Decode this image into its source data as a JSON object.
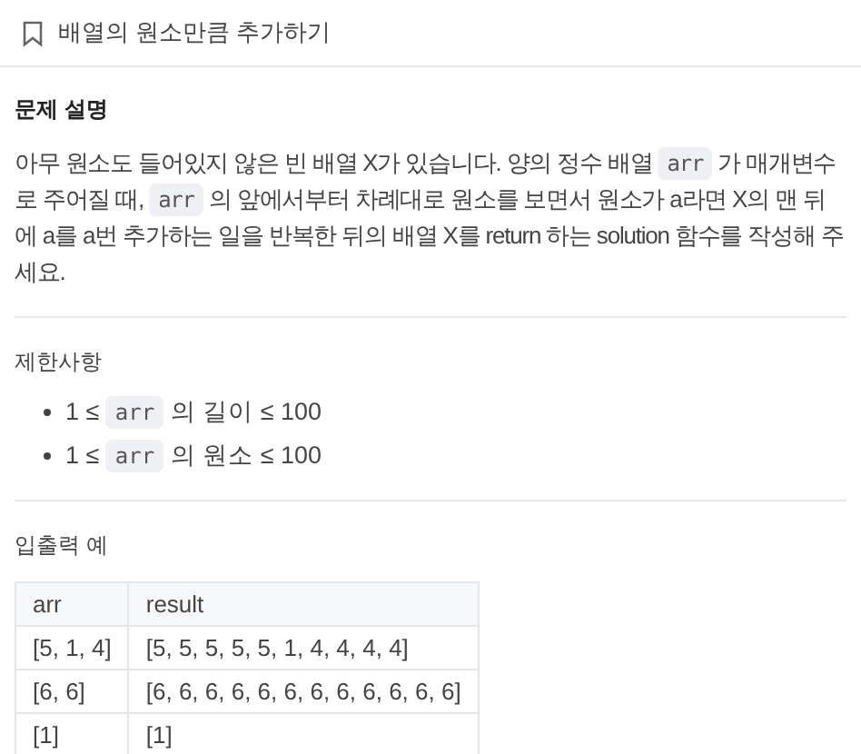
{
  "header": {
    "title": "배열의 원소만큼 추가하기"
  },
  "description": {
    "heading": "문제 설명",
    "paragraph": [
      {
        "kind": "text",
        "text": "아무 원소도 들어있지 않은 빈 배열 X가 있습니다. 양의 정수 배열 "
      },
      {
        "kind": "code",
        "text": "arr"
      },
      {
        "kind": "text",
        "text": " 가 매개변수로 주어질 때, "
      },
      {
        "kind": "code",
        "text": "arr"
      },
      {
        "kind": "text",
        "text": " 의 앞에서부터 차례대로 원소를 보면서 원소가 a라면 X의 맨 뒤에 a를 a번 추가하는 일을 반복한 뒤의 배열 X를 return 하는 solution 함수를 작성해 주세요."
      }
    ]
  },
  "constraints": {
    "heading": "제한사항",
    "items": [
      [
        {
          "kind": "text",
          "text": "1 ≤ "
        },
        {
          "kind": "code",
          "text": "arr"
        },
        {
          "kind": "text",
          "text": " 의 길이 ≤ 100"
        }
      ],
      [
        {
          "kind": "text",
          "text": "1 ≤ "
        },
        {
          "kind": "code",
          "text": "arr"
        },
        {
          "kind": "text",
          "text": " 의 원소 ≤ 100"
        }
      ]
    ]
  },
  "examples": {
    "heading": "입출력 예",
    "table": {
      "columns": [
        "arr",
        "result"
      ],
      "rows": [
        [
          "[5, 1, 4]",
          "[5, 5, 5, 5, 5, 1, 4, 4, 4, 4]"
        ],
        [
          "[6, 6]",
          "[6, 6, 6, 6, 6, 6, 6, 6, 6, 6, 6, 6]"
        ],
        [
          "[1]",
          "[1]"
        ]
      ]
    }
  }
}
